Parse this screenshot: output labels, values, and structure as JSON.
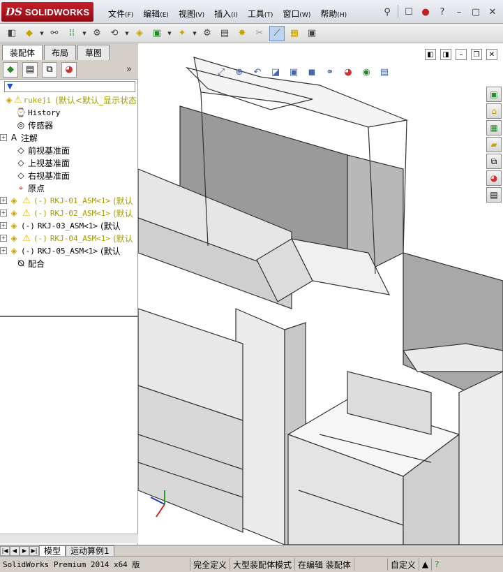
{
  "app": {
    "logo_text": "SOLIDWORKS",
    "logo_mark": "DS"
  },
  "menus": [
    {
      "label": "文件",
      "key": "(F)"
    },
    {
      "label": "编辑",
      "key": "(E)"
    },
    {
      "label": "视图",
      "key": "(V)"
    },
    {
      "label": "插入",
      "key": "(I)"
    },
    {
      "label": "工具",
      "key": "(T)"
    },
    {
      "label": "窗口",
      "key": "(W)"
    },
    {
      "label": "帮助",
      "key": "(H)"
    }
  ],
  "panel": {
    "tabs": [
      "装配体",
      "布局",
      "草图"
    ]
  },
  "tree": {
    "root": {
      "label": "rukeji",
      "state": "(默认<默认_显示状态"
    },
    "items": [
      {
        "label": "History"
      },
      {
        "label": "传感器"
      },
      {
        "label": "注解"
      },
      {
        "label": "前视基准面"
      },
      {
        "label": "上视基准面"
      },
      {
        "label": "右视基准面"
      },
      {
        "label": "原点"
      },
      {
        "prefix": "(-)",
        "label": "RKJ-01_ASM<1>",
        "state": "(默认"
      },
      {
        "prefix": "(-)",
        "label": "RKJ-02_ASM<1>",
        "state": "(默认"
      },
      {
        "prefix": "(-)",
        "label": "RKJ-03_ASM<1>",
        "state": "(默认"
      },
      {
        "prefix": "(-)",
        "label": "RKJ-04_ASM<1>",
        "state": "(默认"
      },
      {
        "prefix": "(-)",
        "label": "RKJ-05_ASM<1>",
        "state": "(默认"
      },
      {
        "label": "配合"
      }
    ]
  },
  "bottom_tabs": [
    "模型",
    "运动算例1"
  ],
  "status": {
    "app": "SolidWorks Premium 2014 x64 版",
    "define": "完全定义",
    "mode": "大型装配体模式",
    "editing": "在编辑 装配体",
    "custom": "自定义"
  },
  "colors": {
    "viewport_bg": "#ffffff",
    "panel_bg": "#d4d0c8",
    "logo_red": "#b0141c",
    "warning": "#e8b800"
  }
}
